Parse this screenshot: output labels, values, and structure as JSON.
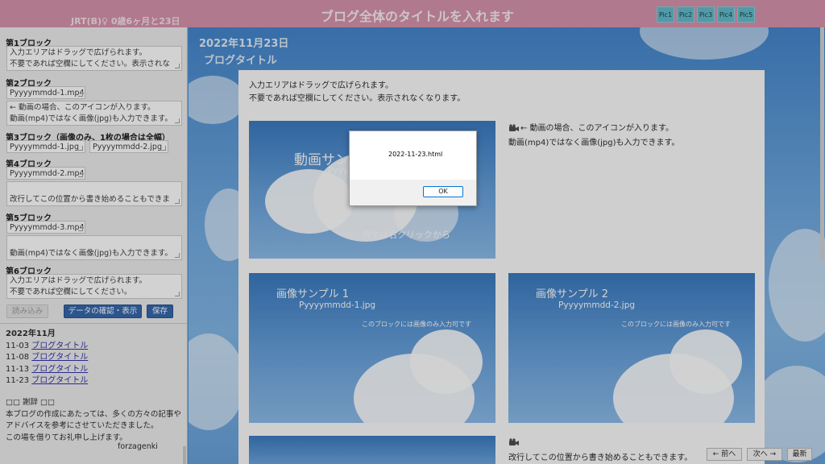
{
  "header": {
    "user_info": "JRT(B)♀ 0歳6ヶ月と23日",
    "blog_title": "ブログ全体のタイトルを入れます",
    "pic_buttons": [
      "Pic1",
      "Pic2",
      "Pic3",
      "Pic4",
      "Pic5"
    ]
  },
  "sidebar": {
    "block1": {
      "label": "第1ブロック",
      "text": "入力エリアはドラッグで広げられます。\n不要であれば空欄にしてください。表示されな"
    },
    "block2": {
      "label": "第2ブロック",
      "file": "Pyyyymmdd-1.mp4",
      "text": "← 動画の場合、このアイコンが入ります。\n動画(mp4)ではなく画像(jpg)も入力できます。"
    },
    "block3": {
      "label": "第3ブロック（画像のみ、1枚の場合は全幅）",
      "file1": "Pyyyymmdd-1.jpg",
      "file2": "Pyyyymmdd-2.jpg"
    },
    "block4": {
      "label": "第4ブロック",
      "file": "Pyyyymmdd-2.mp4",
      "text": "\n改行してこの位置から書き始めることもできま"
    },
    "block5": {
      "label": "第5ブロック",
      "file": "Pyyyymmdd-3.mp4",
      "text": "\n動画(mp4)ではなく画像(jpg)も入力できます。"
    },
    "block6": {
      "label": "第6ブロック",
      "text": "入力エリアはドラッグで広げられます。\n不要であれば空欄にしてください。"
    },
    "buttons": {
      "load": "読み込み",
      "confirm": "データの確認・表示",
      "save": "保存"
    },
    "archive": {
      "month": "2022年11月",
      "items": [
        {
          "date": "11-03",
          "title": "ブログタイトル"
        },
        {
          "date": "11-08",
          "title": "ブログタイトル"
        },
        {
          "date": "11-13",
          "title": "ブログタイトル"
        },
        {
          "date": "11-23",
          "title": "ブログタイトル"
        }
      ]
    },
    "thanks": {
      "heading": "□□ 謝辞 □□",
      "line1": "本ブログの作成にあたっては、多くの方々の記事や",
      "line2": "アドバイスを参考にさせていただきました。",
      "line3": "この場を借りてお礼申し上げます。",
      "signature": "forzagenki"
    }
  },
  "main": {
    "date": "2022年11月23日",
    "post_title": "ブログタイトル",
    "intro_line1": "入力エリアはドラッグで広げられます。",
    "intro_line2": "不要であれば空欄にしてください。表示されなくなります。",
    "video_sample": {
      "title": "動画サン",
      "file": "Pyyy",
      "hint": "再生は右クリックから"
    },
    "video_caption_line1": "← 動画の場合、このアイコンが入ります。",
    "video_caption_line2": "動画(mp4)ではなく画像(jpg)も入力できます。",
    "image1": {
      "title": "画像サンプル 1",
      "file": "Pyyyymmdd-1.jpg",
      "note": "このブロックには画像のみ入力可です"
    },
    "image2": {
      "title": "画像サンプル 2",
      "file": "Pyyyymmdd-2.jpg",
      "note": "このブロックには画像のみ入力可です"
    },
    "bottom_caption": "改行してこの位置から書き始めることもできます。"
  },
  "nav": {
    "prev": "← 前へ",
    "next": "次へ →",
    "latest": "最新"
  },
  "dialog": {
    "message": "2022-11-23.html",
    "ok": "OK"
  },
  "icons": {
    "video": "video-camera-icon"
  },
  "colors": {
    "header": "#d58da7",
    "pic_button": "#59b9c9",
    "sidebar_button": "#2b5fa8",
    "dialog_ok_border": "#0078d7"
  }
}
